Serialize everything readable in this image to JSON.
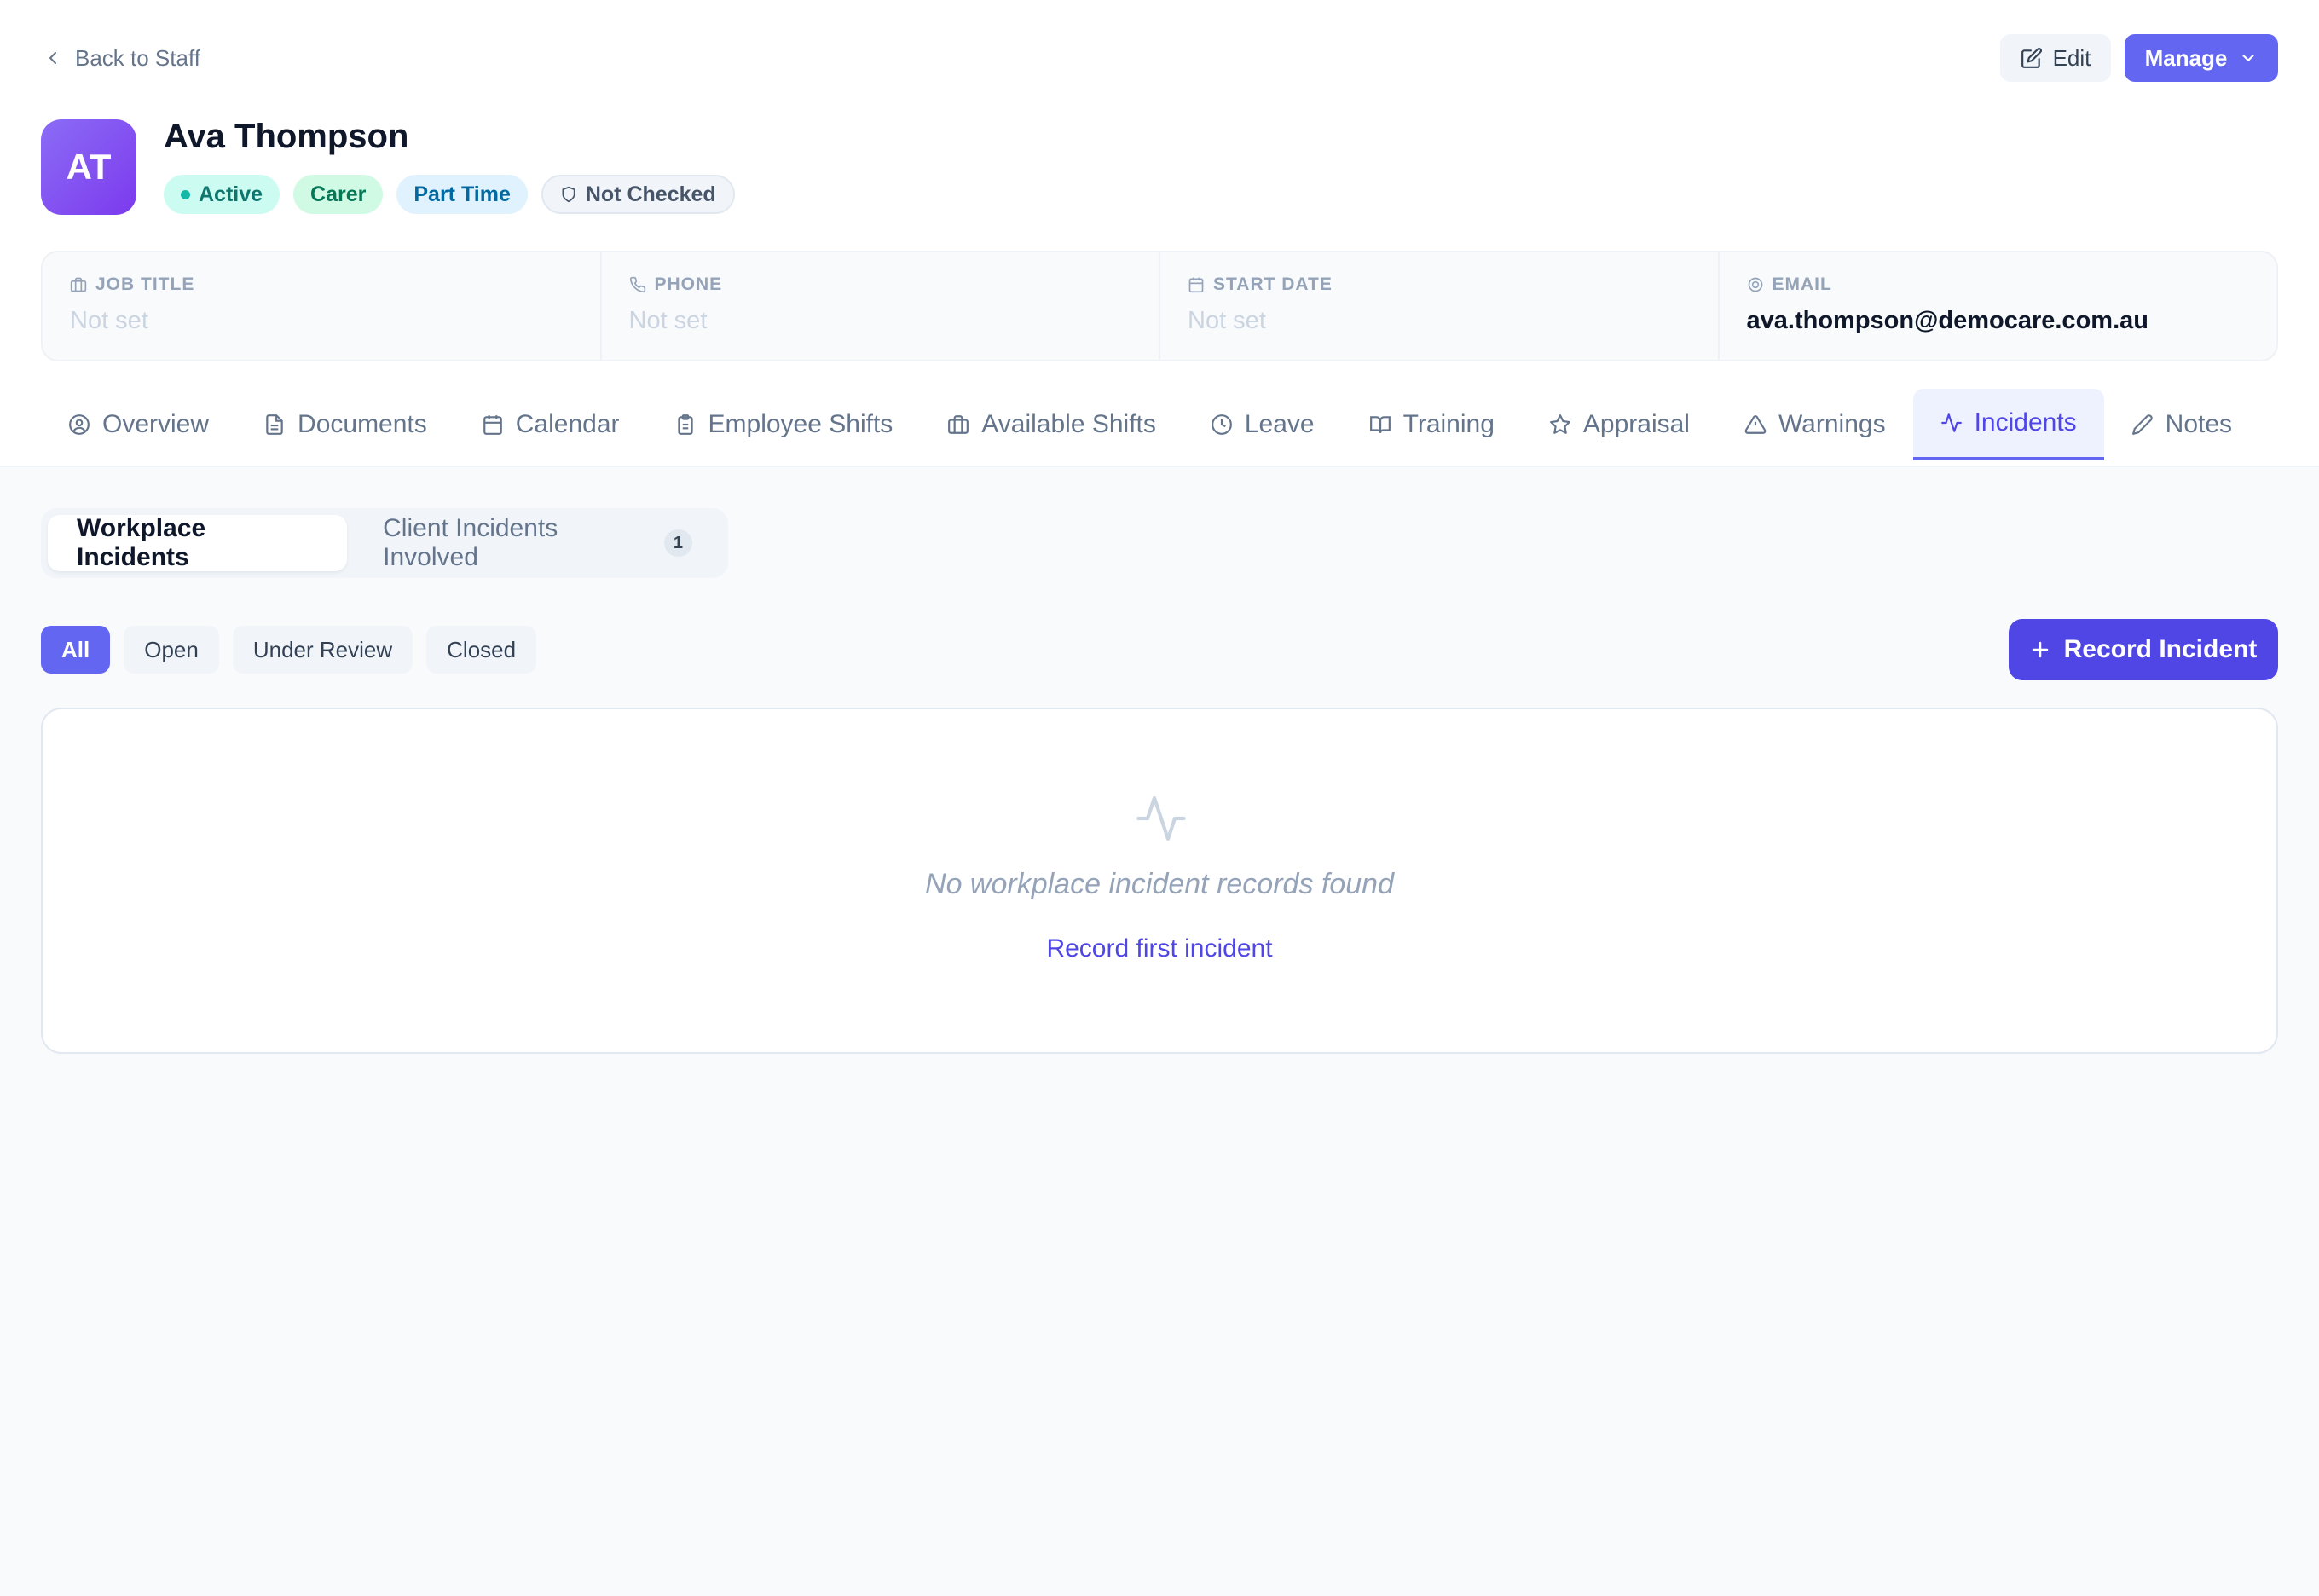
{
  "header": {
    "back_label": "Back to Staff",
    "edit_label": "Edit",
    "manage_label": "Manage"
  },
  "profile": {
    "initials": "AT",
    "name": "Ava Thompson",
    "badges": {
      "status": "Active",
      "role": "Carer",
      "employment": "Part Time",
      "check": "Not Checked"
    }
  },
  "info": {
    "job_title": {
      "label": "JOB TITLE",
      "value": "Not set"
    },
    "phone": {
      "label": "PHONE",
      "value": "Not set"
    },
    "start_date": {
      "label": "START DATE",
      "value": "Not set"
    },
    "email": {
      "label": "EMAIL",
      "value": "ava.thompson@democare.com.au"
    }
  },
  "tabs": [
    {
      "label": "Overview",
      "icon": "user-circle-icon"
    },
    {
      "label": "Documents",
      "icon": "document-icon"
    },
    {
      "label": "Calendar",
      "icon": "calendar-icon"
    },
    {
      "label": "Employee Shifts",
      "icon": "clipboard-icon"
    },
    {
      "label": "Available Shifts",
      "icon": "briefcase-icon"
    },
    {
      "label": "Leave",
      "icon": "clock-icon"
    },
    {
      "label": "Training",
      "icon": "book-icon"
    },
    {
      "label": "Appraisal",
      "icon": "star-icon"
    },
    {
      "label": "Warnings",
      "icon": "warning-icon"
    },
    {
      "label": "Incidents",
      "icon": "activity-icon",
      "active": true
    },
    {
      "label": "Notes",
      "icon": "pencil-icon"
    }
  ],
  "subtabs": {
    "workplace": "Workplace Incidents",
    "client": "Client Incidents Involved",
    "client_count": "1"
  },
  "filters": {
    "all": "All",
    "open": "Open",
    "under_review": "Under Review",
    "closed": "Closed"
  },
  "record_button": "Record Incident",
  "empty": {
    "message": "No workplace incident records found",
    "link": "Record first incident"
  },
  "colors": {
    "accent": "#6366f1",
    "accent_dark": "#4f46e5",
    "active_badge": "#ccfbf1",
    "role_badge": "#d1fae5",
    "type_badge": "#e0f2fe"
  }
}
